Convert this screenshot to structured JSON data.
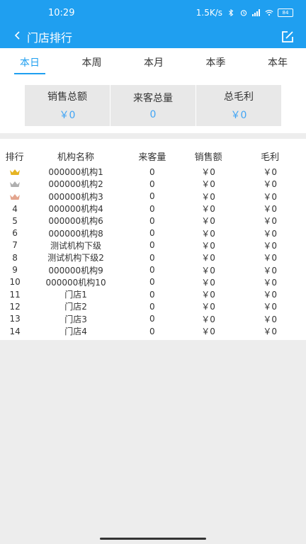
{
  "status": {
    "time": "10:29",
    "speed": "1.5K/s",
    "battery": "84"
  },
  "nav": {
    "title": "门店排行"
  },
  "tabs": [
    {
      "label": "本日",
      "active": true
    },
    {
      "label": "本周",
      "active": false
    },
    {
      "label": "本月",
      "active": false
    },
    {
      "label": "本季",
      "active": false
    },
    {
      "label": "本年",
      "active": false
    }
  ],
  "summary": [
    {
      "label": "销售总额",
      "value": "￥0"
    },
    {
      "label": "来客总量",
      "value": "0"
    },
    {
      "label": "总毛利",
      "value": "￥0"
    }
  ],
  "colors": {
    "primary": "#1f9ff0",
    "gold": "#e6b422",
    "silver": "#b0b0b0",
    "bronze": "#e3a58e"
  },
  "table": {
    "headers": [
      "排行",
      "机构名称",
      "来客量",
      "销售额",
      "毛利"
    ],
    "rows": [
      {
        "rank": "",
        "crown": "gold-crown-icon",
        "name": "000000机构1",
        "visitors": "0",
        "sales": "￥0",
        "profit": "￥0"
      },
      {
        "rank": "",
        "crown": "silver-crown-icon",
        "name": "000000机构2",
        "visitors": "0",
        "sales": "￥0",
        "profit": "￥0"
      },
      {
        "rank": "",
        "crown": "bronze-crown-icon",
        "name": "000000机构3",
        "visitors": "0",
        "sales": "￥0",
        "profit": "￥0"
      },
      {
        "rank": "4",
        "name": "000000机构4",
        "visitors": "0",
        "sales": "￥0",
        "profit": "￥0"
      },
      {
        "rank": "5",
        "name": "000000机构6",
        "visitors": "0",
        "sales": "￥0",
        "profit": "￥0"
      },
      {
        "rank": "6",
        "name": "000000机构8",
        "visitors": "0",
        "sales": "￥0",
        "profit": "￥0"
      },
      {
        "rank": "7",
        "name": "测试机构下级",
        "visitors": "0",
        "sales": "￥0",
        "profit": "￥0"
      },
      {
        "rank": "8",
        "name": "测试机构下级2",
        "visitors": "0",
        "sales": "￥0",
        "profit": "￥0"
      },
      {
        "rank": "9",
        "name": "000000机构9",
        "visitors": "0",
        "sales": "￥0",
        "profit": "￥0"
      },
      {
        "rank": "10",
        "name": "000000机构10",
        "visitors": "0",
        "sales": "￥0",
        "profit": "￥0"
      },
      {
        "rank": "11",
        "name": "门店1",
        "visitors": "0",
        "sales": "￥0",
        "profit": "￥0"
      },
      {
        "rank": "12",
        "name": "门店2",
        "visitors": "0",
        "sales": "￥0",
        "profit": "￥0"
      },
      {
        "rank": "13",
        "name": "门店3",
        "visitors": "0",
        "sales": "￥0",
        "profit": "￥0"
      },
      {
        "rank": "14",
        "name": "门店4",
        "visitors": "0",
        "sales": "￥0",
        "profit": "￥0"
      }
    ]
  }
}
